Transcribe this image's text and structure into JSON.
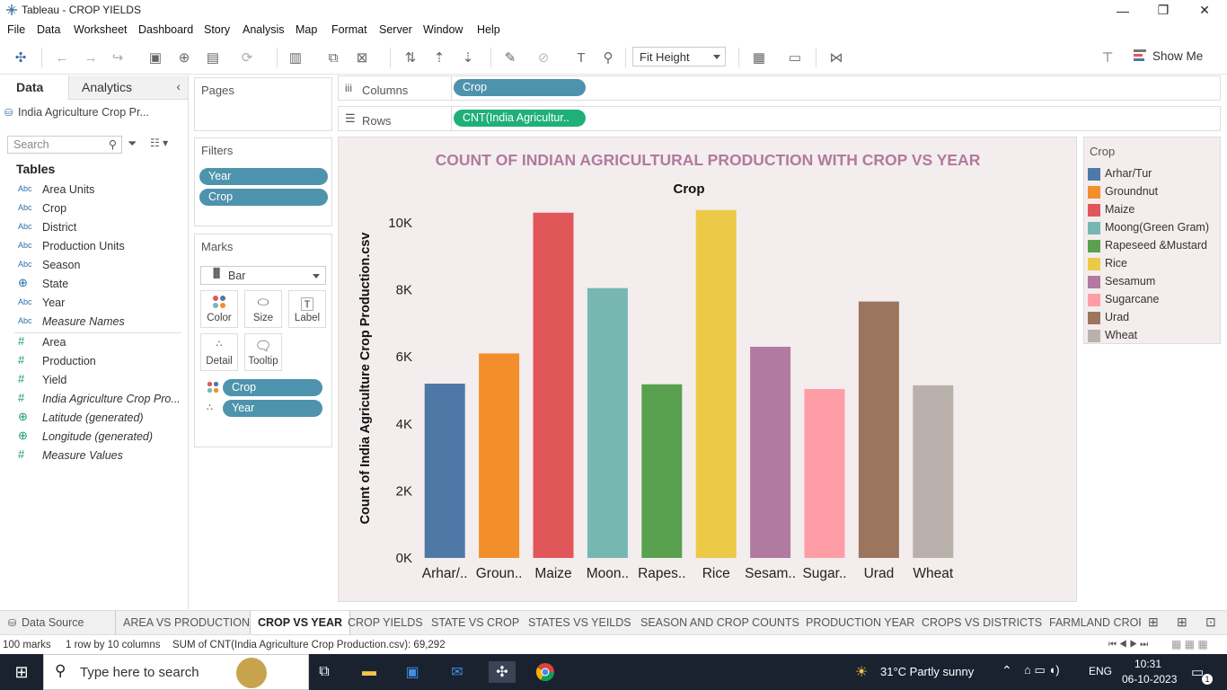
{
  "window": {
    "title": "Tableau - CROP YIELDS",
    "minimize": "—",
    "restore": "❐",
    "close": "✕"
  },
  "menu": [
    "File",
    "Data",
    "Worksheet",
    "Dashboard",
    "Story",
    "Analysis",
    "Map",
    "Format",
    "Server",
    "Window",
    "Help"
  ],
  "toolbar": {
    "fit_select": "Fit Height",
    "show_me": "Show Me"
  },
  "left_pane": {
    "tab_data": "Data",
    "tab_analytics": "Analytics",
    "datasource": "India Agriculture Crop Pr...",
    "search_placeholder": "Search",
    "tables_header": "Tables",
    "fields": [
      {
        "type": "Abc",
        "name": "Area Units",
        "italic": false,
        "kind": "dim"
      },
      {
        "type": "Abc",
        "name": "Crop",
        "italic": false,
        "kind": "dim"
      },
      {
        "type": "Abc",
        "name": "District",
        "italic": false,
        "kind": "dim"
      },
      {
        "type": "Abc",
        "name": "Production Units",
        "italic": false,
        "kind": "dim"
      },
      {
        "type": "Abc",
        "name": "Season",
        "italic": false,
        "kind": "dim"
      },
      {
        "type": "globe",
        "name": "State",
        "italic": false,
        "kind": "dim"
      },
      {
        "type": "Abc",
        "name": "Year",
        "italic": false,
        "kind": "dim"
      },
      {
        "type": "Abc",
        "name": "Measure Names",
        "italic": true,
        "kind": "dim"
      },
      {
        "type": "#",
        "name": "Area",
        "italic": false,
        "kind": "measure"
      },
      {
        "type": "#",
        "name": "Production",
        "italic": false,
        "kind": "measure"
      },
      {
        "type": "#",
        "name": "Yield",
        "italic": false,
        "kind": "measure"
      },
      {
        "type": "#",
        "name": "India Agriculture Crop Pro...",
        "italic": true,
        "kind": "measure"
      },
      {
        "type": "globe",
        "name": "Latitude (generated)",
        "italic": true,
        "kind": "measure"
      },
      {
        "type": "globe",
        "name": "Longitude (generated)",
        "italic": true,
        "kind": "measure"
      },
      {
        "type": "#",
        "name": "Measure Values",
        "italic": true,
        "kind": "measure"
      }
    ]
  },
  "pages": {
    "title": "Pages"
  },
  "filters": {
    "title": "Filters",
    "items": [
      "Year",
      "Crop"
    ]
  },
  "marks": {
    "title": "Marks",
    "type": "Bar",
    "buttons": [
      "Color",
      "Size",
      "Label",
      "Detail",
      "Tooltip"
    ],
    "pills": [
      "Crop",
      "Year"
    ]
  },
  "shelves": {
    "columns_label": "Columns",
    "columns_pill": "Crop",
    "rows_label": "Rows",
    "rows_pill": "CNT(India Agricultur.."
  },
  "chart_data": {
    "type": "bar",
    "title": "COUNT OF INDIAN AGRICULTURAL PRODUCTION WITH CROP VS YEAR",
    "xlabel": "Crop",
    "ylabel": "Count of India Agriculture Crop Production.csv",
    "categories": [
      "Arhar/Tur",
      "Groundnut",
      "Maize",
      "Moong(Green Gram)",
      "Rapeseed &Mustard",
      "Rice",
      "Sesamum",
      "Sugarcane",
      "Urad",
      "Wheat"
    ],
    "tick_labels": [
      "Arhar/..",
      "Groun..",
      "Maize",
      "Moon..",
      "Rapes..",
      "Rice",
      "Sesam..",
      "Sugar..",
      "Urad",
      "Wheat"
    ],
    "values": [
      5200,
      6100,
      10300,
      8050,
      5180,
      10380,
      6300,
      5040,
      7650,
      5150
    ],
    "colors": [
      "#4e79a7",
      "#f28e2b",
      "#e15759",
      "#76b7b2",
      "#59a14f",
      "#edc948",
      "#b07aa1",
      "#ff9da7",
      "#9c755f",
      "#bab0ac"
    ],
    "ylim": [
      0,
      10400
    ],
    "yticks": [
      0,
      2000,
      4000,
      6000,
      8000,
      10000
    ],
    "ytick_labels": [
      "0K",
      "2K",
      "4K",
      "6K",
      "8K",
      "10K"
    ],
    "grid": false,
    "legend_title": "Crop",
    "legend_position": "right"
  },
  "sheet_tabs": {
    "data_source": "Data Source",
    "tabs": [
      "AREA VS PRODUCTION",
      "CROP VS YEAR",
      "CROP YIELDS",
      "STATE VS CROP",
      "STATES VS YEILDS",
      "SEASON AND CROP COUNTS",
      "PRODUCTION YEAR",
      "CROPS VS DISTRICTS",
      "FARMLAND CROP"
    ],
    "active": "CROP VS YEAR"
  },
  "status": {
    "marks": "100 marks",
    "rows_cols": "1 row by 10 columns",
    "sum": "SUM of CNT(India Agriculture Crop Production.csv): 69,292"
  },
  "taskbar": {
    "search_placeholder": "Type here to search",
    "weather": "31°C  Partly sunny",
    "lang": "ENG",
    "time": "10:31",
    "date": "06-10-2023",
    "notif_count": "1"
  }
}
